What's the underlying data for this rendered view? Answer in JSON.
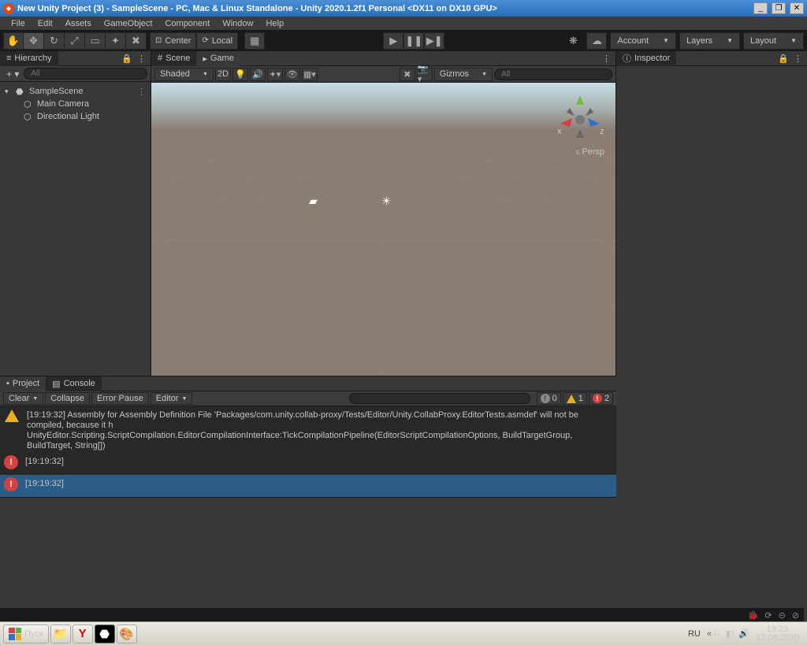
{
  "titlebar": {
    "title": "New Unity Project (3) - SampleScene - PC, Mac & Linux Standalone - Unity 2020.1.2f1 Personal <DX11 on DX10 GPU>"
  },
  "menubar": [
    "File",
    "Edit",
    "Assets",
    "GameObject",
    "Component",
    "Window",
    "Help"
  ],
  "toolbar": {
    "center": "Center",
    "local": "Local",
    "account": "Account",
    "layers": "Layers",
    "layout": "Layout"
  },
  "hierarchy": {
    "tab": "Hierarchy",
    "search_placeholder": "All",
    "scene": "SampleScene",
    "items": [
      "Main Camera",
      "Directional Light"
    ]
  },
  "scene": {
    "tab_scene": "Scene",
    "tab_game": "Game",
    "shading": "Shaded",
    "mode2d": "2D",
    "gizmos": "Gizmos",
    "search_placeholder": "All",
    "persp": "Persp",
    "x": "x",
    "z": "z"
  },
  "inspector": {
    "tab": "Inspector"
  },
  "console": {
    "tab_project": "Project",
    "tab_console": "Console",
    "clear": "Clear",
    "collapse": "Collapse",
    "error_pause": "Error Pause",
    "editor": "Editor",
    "count_info": "0",
    "count_warn": "1",
    "count_err": "2",
    "rows": [
      {
        "type": "warn",
        "time": "[19:19:32]",
        "msg": "Assembly for Assembly Definition File 'Packages/com.unity.collab-proxy/Tests/Editor/Unity.CollabProxy.EditorTests.asmdef' will not be compiled, because it h",
        "msg2": "UnityEditor.Scripting.ScriptCompilation.EditorCompilationInterface:TickCompilationPipeline(EditorScriptCompilationOptions, BuildTargetGroup, BuildTarget, String[])"
      },
      {
        "type": "err",
        "time": "[19:19:32]",
        "msg": ""
      },
      {
        "type": "err",
        "time": "[19:19:32]",
        "msg": "",
        "selected": true
      }
    ]
  },
  "taskbar": {
    "start": "Пуск",
    "lang": "RU",
    "time": "19:23",
    "date": "17.08.2020"
  }
}
